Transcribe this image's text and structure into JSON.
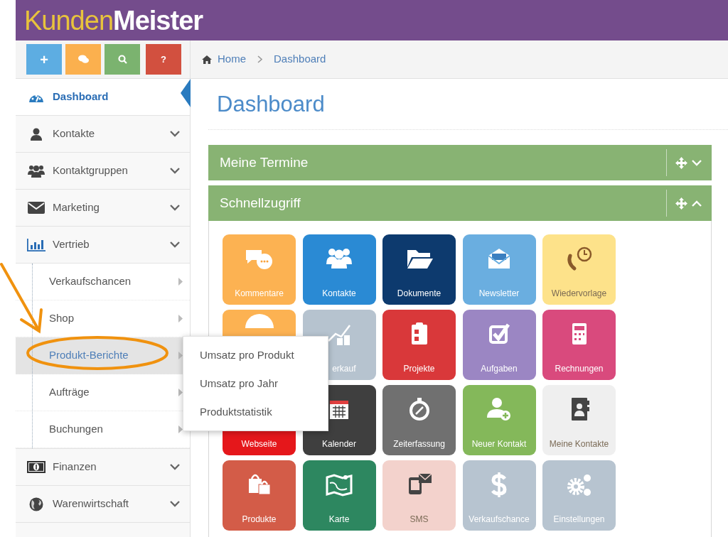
{
  "logo": "Kunden**Meister**",
  "quick_actions": [
    {
      "kind": "glyph",
      "text": "+",
      "color": "#5dade2"
    },
    {
      "kind": "icon",
      "color": "#fbb04e"
    },
    {
      "kind": "icon",
      "color": "#7bb36f"
    },
    {
      "kind": "glyph",
      "text": "?",
      "color": "#d2503f"
    }
  ],
  "sidebar": {
    "items": [
      {
        "kind": "link",
        "label": "Dashboard",
        "selected": true
      },
      {
        "kind": "menu",
        "label": "Kontakte",
        "selected": false
      },
      {
        "kind": "menu",
        "label": "Kontaktgruppen",
        "selected": false
      },
      {
        "kind": "menu",
        "label": "Marketing",
        "selected": false
      },
      {
        "kind": "menu",
        "label": "Vertrieb",
        "selected": false,
        "children": [
          {
            "label": "Verkaufschancen",
            "selected": false
          },
          {
            "label": "Shop",
            "selected": false
          },
          {
            "label": "Produkt-Berichte",
            "selected": true
          },
          {
            "label": "Aufträge",
            "selected": false
          },
          {
            "label": "Buchungen",
            "selected": false
          }
        ]
      },
      {
        "kind": "menu",
        "label": "Finanzen",
        "selected": false
      },
      {
        "kind": "menu",
        "label": "Warenwirtschaft",
        "selected": false
      }
    ]
  },
  "breadcrumb": [
    "Home",
    "Dashboard"
  ],
  "page_title": "Dashboard",
  "panels": [
    {
      "title": "Meine Termine",
      "expanded": false
    },
    {
      "title": "Schnellzugriff",
      "expanded": true,
      "tiles": [
        {
          "label": "Kommentare",
          "color": "#fcb252"
        },
        {
          "label": "Kontakte",
          "color": "#2a8ad4"
        },
        {
          "label": "Dokumente",
          "color": "#0d3a6e"
        },
        {
          "label": "Newsletter",
          "color": "#6aaee0"
        },
        {
          "label": "Wiedervorlage",
          "color": "#fde28a"
        },
        {
          "color": "#fcb252"
        },
        {
          "label": "erkauf",
          "color": "#b6c3cf",
          "kind": "partly_covered"
        },
        {
          "label": "Projekte",
          "color": "#d9383a"
        },
        {
          "label": "Aufgaben",
          "color": "#9b86c3"
        },
        {
          "label": "Rechnungen",
          "color": "#d94a7d"
        },
        {
          "label": "Webseite",
          "color": "#e5171b"
        },
        {
          "label": "Kalender",
          "color": "#3f3f3f"
        },
        {
          "label": "Zeiterfassung",
          "color": "#707070"
        },
        {
          "label": "Neuer Kontakt",
          "color": "#84b85a"
        },
        {
          "label": "Meine Kontakte",
          "color": "#efefef"
        },
        {
          "label": "Produkte",
          "color": "#d35c48"
        },
        {
          "label": "Karte",
          "color": "#2d8760"
        },
        {
          "label": "SMS",
          "color": "#f3d2cc"
        },
        {
          "label": "Verkaufschance",
          "color": "#b7c4d0"
        },
        {
          "label": "Einstellungen",
          "color": "#b7c4d0"
        }
      ]
    }
  ],
  "popup_menu": [
    "Umsatz pro Produkt",
    "Umsatz pro Jahr",
    "Produktstatistik"
  ]
}
